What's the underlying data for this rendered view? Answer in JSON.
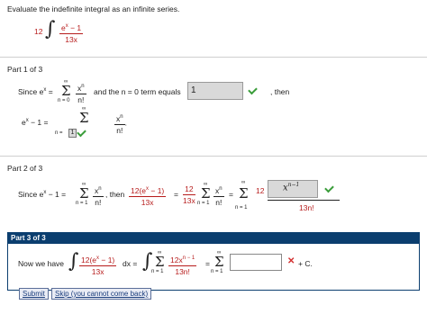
{
  "problem": {
    "instruction": "Evaluate the indefinite integral as an infinite series.",
    "coef": "12",
    "integral_sign": "∫",
    "num": "e",
    "num_exp": "x",
    "num_tail": " − 1",
    "den": "13x"
  },
  "part1": {
    "title": "Part 1 of 3",
    "since": "Since  e",
    "since_exp": "x",
    "eq": " =",
    "sum_top": "∞",
    "sum_bottom": "n = 0",
    "sigma": "Σ",
    "term_num": "x",
    "term_num_exp": "n",
    "term_den": "n!",
    "and_text": "and the n = 0 term equals",
    "answer_value": "1",
    "then_text": ", then",
    "lhs": "e",
    "lhs_exp": "x",
    "lhs_tail": " − 1 =",
    "sum2_top": "∞",
    "sum2_bottom_prefix": "n =",
    "sum2_bottom_value": "1",
    "term2_num": "x",
    "term2_num_exp": "n",
    "term2_den": "n!",
    "term2_tail": "."
  },
  "part2": {
    "title": "Part 2 of 3",
    "since": "Since  e",
    "since_exp": "x",
    "since_tail": " − 1 =",
    "sum_top": "∞",
    "sum_bottom": "n = 1",
    "sigma": "Σ",
    "term_num": "x",
    "term_num_exp": "n",
    "term_den": "n!",
    "then_text": ", then",
    "f1_num": "12(e",
    "f1_num_exp": "x",
    "f1_num_tail": " − 1)",
    "f1_den": "13x",
    "eq1": "=",
    "f2_num": "12",
    "f2_den": "13x",
    "sum3_top": "∞",
    "sum3_bottom": "n = 1",
    "term3_num": "x",
    "term3_num_exp": "n",
    "term3_den": "n!",
    "eq2": "=",
    "sum4_top": "∞",
    "sum4_bottom": "n = 1",
    "ans_coef": "12",
    "ans_num": "x",
    "ans_num_exp": "n−1",
    "ans_den": "13n!"
  },
  "part3": {
    "title": "Part 3 of 3",
    "now": "Now we have",
    "f_num": "12(e",
    "f_num_exp": "x",
    "f_num_tail": " − 1)",
    "f_den": "13x",
    "dx": "dx =",
    "sum_top": "∞",
    "sum_bottom": "n = 1",
    "g_num": "12x",
    "g_num_exp": "n − 1",
    "g_den": "13n!",
    "eq": "=",
    "sum2_top": "∞",
    "sum2_bottom": "n = 1",
    "answer_value": "",
    "plus_c": "+ C."
  },
  "buttons": {
    "submit": "Submit",
    "skip": "Skip (you cannot come back)"
  }
}
